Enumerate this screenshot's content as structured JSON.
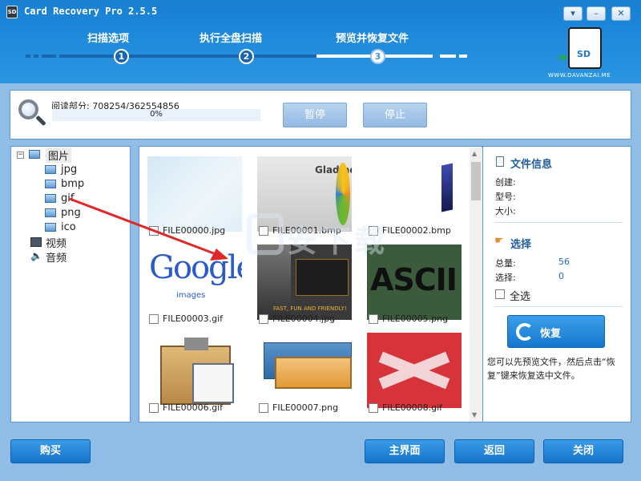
{
  "window": {
    "title": "Card Recovery Pro 2.5.5",
    "website": "WWW.DAVANZAI.ME"
  },
  "steps": [
    {
      "label": "扫描选项",
      "number": "1"
    },
    {
      "label": "执行全盘扫描",
      "number": "2"
    },
    {
      "label": "预览并恢复文件",
      "number": "3"
    }
  ],
  "sd_label": "SD",
  "progress": {
    "read_text": "阅读部分: 708254/362554856",
    "percent_text": "0%",
    "fraction": 0.0,
    "pause_label": "暂停",
    "stop_label": "停止"
  },
  "tree": {
    "root": "图片",
    "children": [
      "jpg",
      "bmp",
      "gif",
      "png",
      "ico"
    ],
    "video": "视频",
    "audio": "音频"
  },
  "files": [
    {
      "name": "FILE00000.jpg",
      "thumb_text": ""
    },
    {
      "name": "FILE00001.bmp",
      "thumb_text": "Gladinet"
    },
    {
      "name": "FILE00002.bmp",
      "thumb_text": ""
    },
    {
      "name": "FILE00003.gif",
      "thumb_text": "Google"
    },
    {
      "name": "FILE00004.jpg",
      "thumb_text": "FAST, FUN AND FRIENDLY!"
    },
    {
      "name": "FILE00005.png",
      "thumb_text": "ASCII"
    },
    {
      "name": "FILE00006.gif",
      "thumb_text": ""
    },
    {
      "name": "FILE00007.png",
      "thumb_text": ""
    },
    {
      "name": "FILE00008.gif",
      "thumb_text": ""
    }
  ],
  "info": {
    "file_info_title": "文件信息",
    "created_label": "创建:",
    "type_label": "型号:",
    "size_label": "大小:",
    "select_title": "选择",
    "total_label": "总量:",
    "total_value": "56",
    "selected_label": "选择:",
    "selected_value": "0",
    "select_all_label": "全选",
    "recover_label": "恢复",
    "note": "您可以先预览文件，然后点击“恢复”键来恢复选中文件。"
  },
  "buttons": {
    "buy": "购买",
    "main": "主界面",
    "back": "返回",
    "close": "关闭"
  },
  "watermark_text": "安下载",
  "colors": {
    "header": "#1b86d9",
    "body": "#8fbde5",
    "button": "#1674cc",
    "arrow": "#e0282a"
  }
}
